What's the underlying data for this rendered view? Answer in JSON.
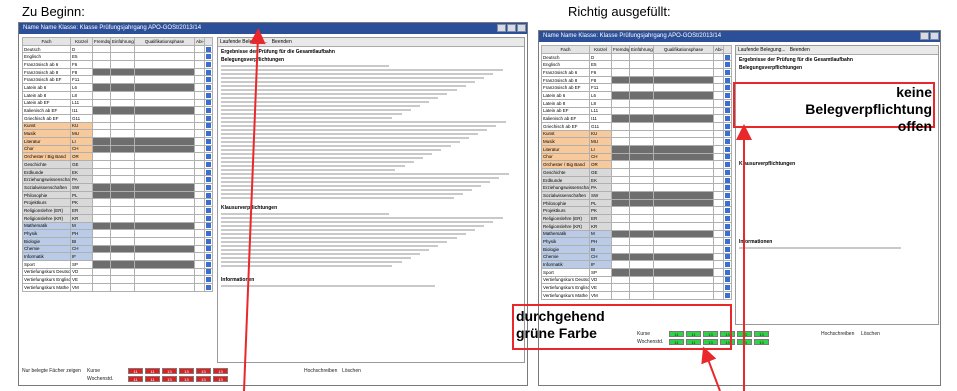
{
  "headings": {
    "left": "Zu Beginn:",
    "right": "Richtig ausgefüllt:"
  },
  "annotations": {
    "top_right_line1": "keine",
    "top_right_line2": "Belegverpflichtung",
    "top_right_line3": "offen",
    "bottom_line1": "durchgehend",
    "bottom_line2": "grüne Farbe"
  },
  "window": {
    "title_left": "Name           Name           Klasse: Klasse     Prüfungsjahrgang APO-GOSt/2013/14",
    "title_right": "Name           Name           Klasse: Klasse     Prüfungsjahrgang APO-GOSt/2013/14"
  },
  "grid_headers": {
    "fach": "Fach",
    "kuerzel": "Kürzel",
    "fremdsp": "Fremdspr.",
    "einfuehrung": "Einführungsphase",
    "qualifikation": "Qualifikationsphase",
    "abi": "Abi-Fach"
  },
  "subjects": [
    {
      "name": "Deutsch",
      "code": "D",
      "color": "default"
    },
    {
      "name": "Englisch",
      "code": "E5",
      "color": "default"
    },
    {
      "name": "Französisch ab 6",
      "code": "F6",
      "color": "default"
    },
    {
      "name": "Französisch ab 8",
      "code": "F8",
      "color": "default"
    },
    {
      "name": "Französisch ab EF",
      "code": "F11",
      "color": "default"
    },
    {
      "name": "Latein ab 6",
      "code": "L6",
      "color": "default"
    },
    {
      "name": "Latein ab 8",
      "code": "L8",
      "color": "default"
    },
    {
      "name": "Latein ab EF",
      "code": "L11",
      "color": "default"
    },
    {
      "name": "Italienisch ab EF",
      "code": "I11",
      "color": "default"
    },
    {
      "name": "Griechisch ab EF",
      "code": "G11",
      "color": "default"
    },
    {
      "name": "Kunst",
      "code": "KU",
      "color": "orange"
    },
    {
      "name": "Musik",
      "code": "MU",
      "color": "orange"
    },
    {
      "name": "Literatur",
      "code": "LI",
      "color": "orange"
    },
    {
      "name": "Chor",
      "code": "CH",
      "color": "orange"
    },
    {
      "name": "Orchester / Big Band",
      "code": "OR",
      "color": "orange"
    },
    {
      "name": "Geschichte",
      "code": "GE",
      "color": "gray"
    },
    {
      "name": "Erdkunde",
      "code": "EK",
      "color": "gray"
    },
    {
      "name": "Erziehungswissenschaft",
      "code": "PA",
      "color": "gray"
    },
    {
      "name": "Sozialwissenschaften",
      "code": "SW",
      "color": "gray"
    },
    {
      "name": "Philosophie",
      "code": "PL",
      "color": "gray"
    },
    {
      "name": "Projektkurs",
      "code": "PK",
      "color": "gray"
    },
    {
      "name": "Religionslehre (ER)",
      "code": "ER",
      "color": "gray"
    },
    {
      "name": "Religionslehre (KR)",
      "code": "KR",
      "color": "gray"
    },
    {
      "name": "Mathematik",
      "code": "M",
      "color": "blue"
    },
    {
      "name": "Physik",
      "code": "PH",
      "color": "blue"
    },
    {
      "name": "Biologie",
      "code": "BI",
      "color": "blue"
    },
    {
      "name": "Chemie",
      "code": "CH",
      "color": "blue"
    },
    {
      "name": "Informatik",
      "code": "IF",
      "color": "blue"
    },
    {
      "name": "Sport",
      "code": "SP",
      "color": "default"
    },
    {
      "name": "Vertiefungskurs Deutsch",
      "code": "VD",
      "color": "default"
    },
    {
      "name": "Vertiefungskurs Englisch",
      "code": "VE",
      "color": "default"
    },
    {
      "name": "Vertiefungskurs Mathe",
      "code": "VM",
      "color": "default"
    }
  ],
  "side_panel": {
    "dropdown": "Laufende Belegung...",
    "button": "Beenden",
    "section1": "Ergebnisse der Prüfung für die Gesamtlaufbahn",
    "section2": "Belegungsverpflichtungen",
    "section3": "Klausurverpflichtungen",
    "section4": "Informationen"
  },
  "bottom": {
    "kurse_label": "Kurse",
    "wochenstd_label": "Wochenstd.",
    "checkbox_label": "Nur belegte Fächer zeigen",
    "loeschen": "Löschen",
    "hochschreiben": "Hochschreiben",
    "left_values": [
      "11",
      "11",
      "13",
      "13",
      "13",
      "13"
    ],
    "right_values": [
      "11",
      "11",
      "13",
      "13",
      "13",
      "13"
    ],
    "red_color": "#e11d1d",
    "green_color": "#33d14a"
  }
}
